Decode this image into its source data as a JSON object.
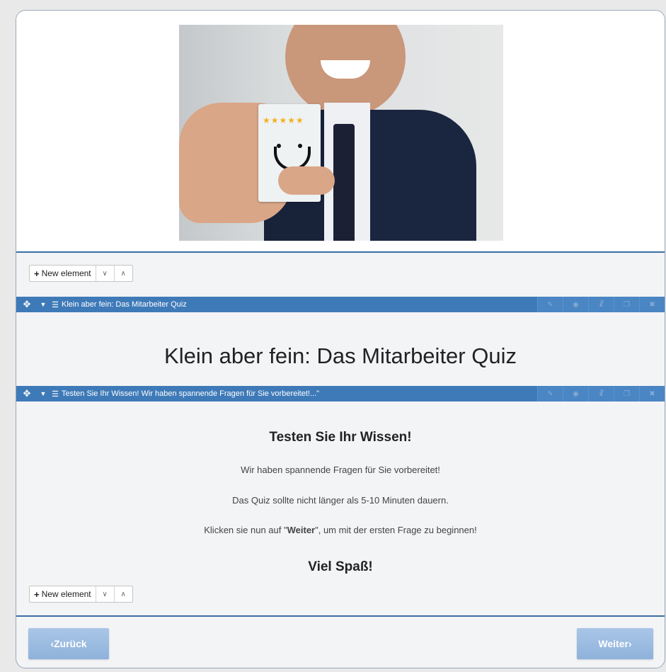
{
  "new_element": {
    "label": "New element",
    "plus": "+",
    "down_arrow": "∨",
    "up_arrow": "∧"
  },
  "bars": [
    {
      "title": "Klein aber fein: Das Mitarbeiter Quiz"
    },
    {
      "title": "Testen Sie Ihr Wissen! Wir haben spannende Fragen für Sie vorbereitet!...\""
    }
  ],
  "toolbar_icons": [
    "pencil-icon",
    "eye-icon",
    "pin-icon",
    "copy-icon",
    "trash-icon"
  ],
  "toolbar_glyphs": [
    "✎",
    "◉",
    "☧",
    "❐",
    "✖"
  ],
  "heading": "Klein aber fein: Das Mitarbeiter Quiz",
  "content": {
    "title": "Testen Sie Ihr Wissen!",
    "line1": "Wir haben spannende Fragen für Sie vorbereitet!",
    "line2": "Das Quiz sollte nicht länger als 5-10 Minuten dauern.",
    "line3_before": "Klicken sie nun auf \"",
    "line3_bold": "Weiter",
    "line3_after": "\", um mit der ersten Frage zu beginnen!",
    "closing": "Viel Spaß!"
  },
  "nav": {
    "back": "‹Zurück",
    "next": "Weiter›"
  },
  "colors": {
    "bar_blue": "#3f7ab8",
    "nav_button": "#9dbde2"
  },
  "image": {
    "stars": "★★★★★"
  }
}
